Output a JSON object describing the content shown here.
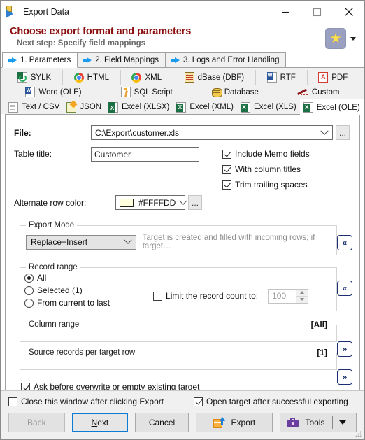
{
  "window": {
    "title": "Export Data",
    "icon": "export-data-icon",
    "minimize_label": "—",
    "maximize_label": "□",
    "close_label": "✕"
  },
  "header": {
    "title": "Choose export format and parameters",
    "subtitle": "Next step: Specify field mappings",
    "favorites_icon": "star-icon",
    "favorites_dropdown_icon": "chevron-down-icon"
  },
  "step_tabs": [
    {
      "label": "1. Parameters",
      "icon": "blue-arrow-icon",
      "active": true
    },
    {
      "label": "2. Field Mappings",
      "icon": "blue-arrow-icon",
      "active": false
    },
    {
      "label": "3. Logs and Error Handling",
      "icon": "blue-arrow-icon",
      "active": false
    }
  ],
  "format_tabs": {
    "row1": [
      {
        "label": "SYLK",
        "icon": "sylk-icon"
      },
      {
        "label": "HTML",
        "icon": "chrome-icon"
      },
      {
        "label": "XML",
        "icon": "chrome-icon"
      },
      {
        "label": "dBase (DBF)",
        "icon": "dbase-icon"
      },
      {
        "label": "RTF",
        "icon": "word-doc-icon"
      },
      {
        "label": "PDF",
        "icon": "pdf-icon"
      }
    ],
    "row2": [
      {
        "label": "Word (OLE)",
        "icon": "word-doc-icon"
      },
      {
        "label": "SQL Script",
        "icon": "sql-script-icon"
      },
      {
        "label": "Database",
        "icon": "database-icon"
      },
      {
        "label": "Custom",
        "icon": "pencil-icon"
      }
    ],
    "row3": [
      {
        "label": "Text / CSV",
        "icon": "text-file-icon",
        "active": false
      },
      {
        "label": "JSON",
        "icon": "json-icon",
        "active": false
      },
      {
        "label": "Excel (XLSX)",
        "icon": "excel-icon",
        "active": false
      },
      {
        "label": "Excel (XML)",
        "icon": "excel-icon",
        "active": false
      },
      {
        "label": "Excel (XLS)",
        "icon": "excel-icon",
        "active": false
      },
      {
        "label": "Excel (OLE)",
        "icon": "excel-icon",
        "active": true
      }
    ]
  },
  "form": {
    "file_label": "File:",
    "file_value": "C:\\Export\\customer.xls",
    "file_browse_label": "...",
    "table_title_label": "Table title:",
    "table_title_value": "Customer",
    "alt_row_color_label": "Alternate row color:",
    "alt_row_color_value": "#FFFFDD",
    "alt_row_color_hex": "#FFFFDD",
    "alt_row_color_browse_label": "...",
    "checks": [
      {
        "label": "Include Memo fields",
        "checked": true
      },
      {
        "label": "With column titles",
        "checked": true
      },
      {
        "label": "Trim trailing spaces",
        "checked": true
      }
    ]
  },
  "export_mode": {
    "group_title": "Export Mode",
    "value": "Replace+Insert",
    "hint": "Target is created and filled with incoming rows; if target…",
    "collapse_icon": "«"
  },
  "record_range": {
    "group_title": "Record range",
    "options": [
      {
        "label": "All",
        "selected": true
      },
      {
        "label": "Selected (1)",
        "selected": false
      },
      {
        "label": "From current to last",
        "selected": false
      }
    ],
    "limit_label": "Limit the record count to:",
    "limit_checked": false,
    "limit_value": "100",
    "collapse_icon": "«"
  },
  "column_range": {
    "group_title": "Column range",
    "value": "[All]",
    "expand_icon": "»"
  },
  "source_records": {
    "group_title": "Source records per target row",
    "value": "[1]",
    "expand_icon": "»"
  },
  "ask_before_overwrite": {
    "label": "Ask before overwrite or empty existing target",
    "checked": true
  },
  "footer": {
    "close_window_check": {
      "label": "Close this window after clicking Export",
      "checked": false
    },
    "open_target_check": {
      "label": "Open target after successful exporting",
      "checked": true
    },
    "buttons": {
      "back": "Back",
      "next_prefix": "",
      "next_underline": "N",
      "next_suffix": "ext",
      "cancel": "Cancel",
      "export": "Export",
      "tools": "Tools"
    }
  },
  "colors": {
    "header_title": "#8b0f0f",
    "accent_blue": "#0a7cd4",
    "chevron_navy": "#1b2f72"
  }
}
